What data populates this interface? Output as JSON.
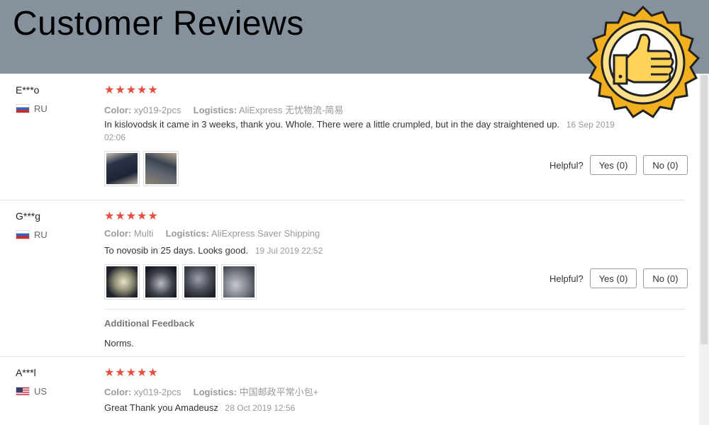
{
  "header": {
    "title": "Customer Reviews"
  },
  "badge": {
    "icon": "thumbs-up-icon",
    "colors": {
      "outer": "#f2b01e",
      "ring": "#ffe08a",
      "inner": "#ffffff"
    }
  },
  "labels": {
    "color": "Color:",
    "logistics": "Logistics:",
    "helpful": "Helpful?",
    "additional_feedback": "Additional Feedback"
  },
  "star_color": "#e74c3c",
  "reviews": [
    {
      "user": "E***o",
      "country": "RU",
      "rating": 5,
      "color": "xy019-2pcs",
      "logistics": "AliExpress 无忧物流-简易",
      "text": "In kislovodsk it came in 3 weeks, thank you. Whole. There were a little crumpled, but in the day straightened up.",
      "date": "16 Sep 2019 02:06",
      "yes": "Yes (0)",
      "no": "No (0)",
      "photos": 2
    },
    {
      "user": "G***g",
      "country": "RU",
      "rating": 5,
      "color": "Multi",
      "logistics": "AliExpress Saver Shipping",
      "text": "To novosib in 25 days. Looks good.",
      "date": "19 Jul 2019 22:52",
      "yes": "Yes (0)",
      "no": "No (0)",
      "photos": 4,
      "additional": "Norms."
    },
    {
      "user": "A***l",
      "country": "US",
      "rating": 5,
      "color": "xy019-2pcs",
      "logistics": "中国邮政平常小包+",
      "text": "Great Thank you Amadeusz",
      "date": "28 Oct 2019 12:56"
    }
  ]
}
